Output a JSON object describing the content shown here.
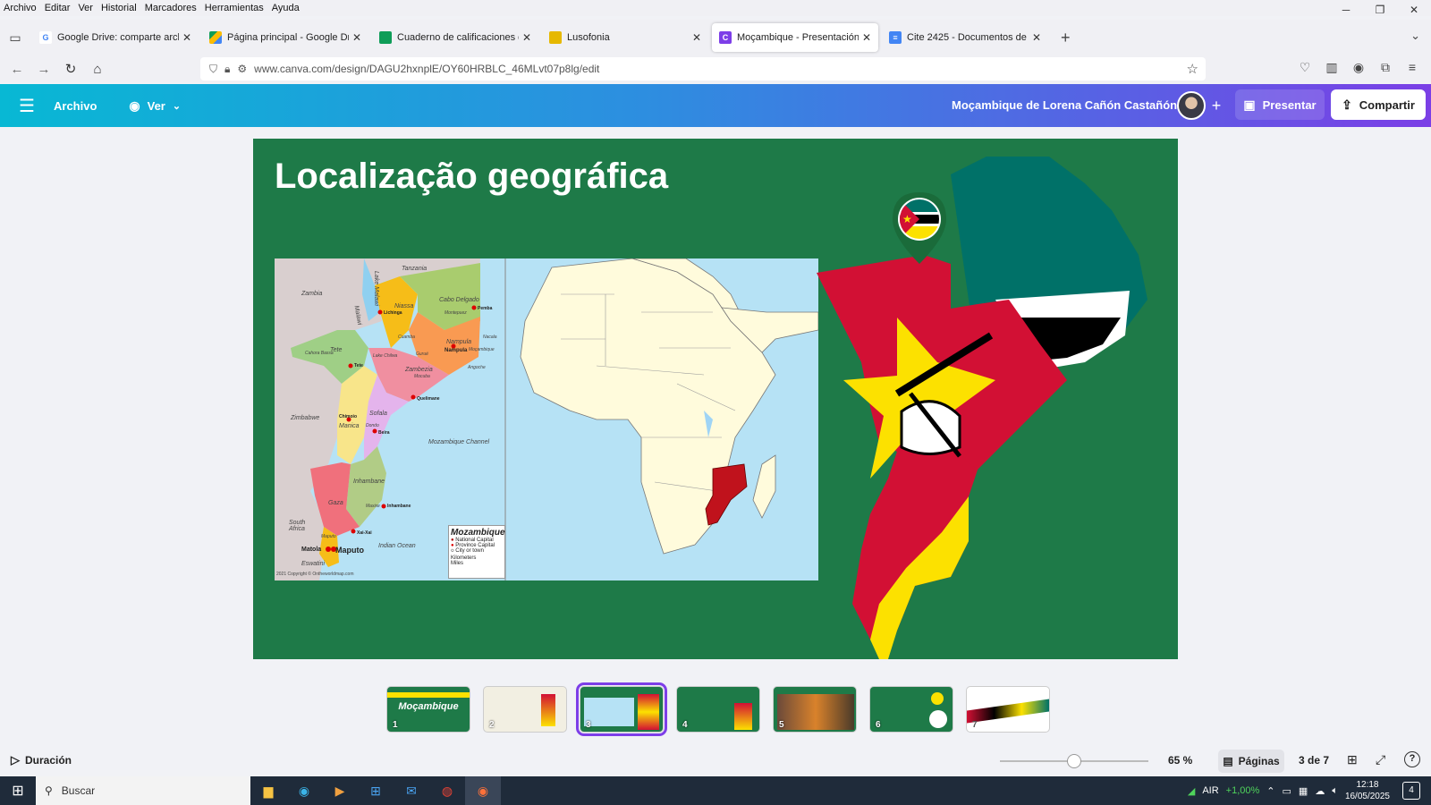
{
  "menubar": {
    "items": [
      "Archivo",
      "Editar",
      "Ver",
      "Historial",
      "Marcadores",
      "Herramientas",
      "Ayuda"
    ]
  },
  "tabs": [
    {
      "label": "Google Drive: comparte archivos",
      "favicon": "google-icon",
      "color": "#4285f4",
      "active": false
    },
    {
      "label": "Página principal - Google Drive",
      "favicon": "drive-icon",
      "color": "#0f9d58",
      "active": false
    },
    {
      "label": "Cuaderno de calificaciones de 2",
      "favicon": "classroom-icon",
      "color": "#0f9d58",
      "active": false
    },
    {
      "label": "Lusofonia",
      "favicon": "classroom-icon",
      "color": "#e6b800",
      "active": false
    },
    {
      "label": "Moçambique - Presentación",
      "favicon": "canva-icon",
      "color": "#7d3ee8",
      "active": true
    },
    {
      "label": "Cite 2425 - Documentos de Goo",
      "favicon": "docs-icon",
      "color": "#4285f4",
      "active": false
    }
  ],
  "url": "www.canva.com/design/DAGU2hxnplE/OY60HRBLC_46MLvt07p8lg/edit",
  "canva": {
    "archivo": "Archivo",
    "ver": "Ver",
    "doc_title": "Moçambique de Lorena Cañón Castañón",
    "present": "Presentar",
    "share": "Compartir"
  },
  "slide": {
    "title": "Localização geográfica",
    "map_labels": {
      "tanzania": "Tanzania",
      "zambia": "Zambia",
      "lake_malawi": "Lake Malawi",
      "malawi": "Malawi",
      "niassa": "Niassa",
      "cabo_delgado": "Cabo Delgado",
      "lichinga": "Lichinga",
      "pemba": "Pemba",
      "nampula_prov": "Nampula",
      "nampula_city": "Nampula",
      "nacala": "Nacala",
      "cuamba": "Cuamba",
      "gurue": "Gurué",
      "tete_prov": "Tete",
      "tete_city": "Tete",
      "cahora_bassa": "Cahora Bassa",
      "lake_chilwa": "Lake Chilwa",
      "zambezia": "Zambezia",
      "mocuba": "Mocuba",
      "quelimane": "Quelimane",
      "angoche": "Angoche",
      "mozambique_island": "Moçambique",
      "montepuez": "Montepuez",
      "zimbabwe": "Zimbabwe",
      "chimoio": "Chimoio",
      "manica": "Manica",
      "sofala": "Sofala",
      "dondo": "Dondo",
      "beira": "Beira",
      "mozambique_channel": "Mozambique Channel",
      "inhambane_prov": "Inhambane",
      "inhambane_city": "Inhambane",
      "maxixe": "Maxixe",
      "gaza": "Gaza",
      "xai_xai": "Xai-Xai",
      "south_africa": "South Africa",
      "maputo_prov": "Maputo",
      "matola": "Matola",
      "maputo_city": "Maputo",
      "indian_ocean": "Indian Ocean",
      "eswatini": "Eswatini",
      "copyright": "2021 Copyright © Ontheworldmap.com"
    },
    "legend": {
      "title": "Mozambique",
      "national_capital": "National Capital",
      "province_capital": "Province Capital",
      "city": "City or town",
      "km": "Kilometers",
      "miles": "Miles"
    }
  },
  "thumbnails": [
    {
      "num": "1",
      "text": "Moçambique",
      "bg": "#1e7a48"
    },
    {
      "num": "2",
      "text": "",
      "bg": "#f2efe2"
    },
    {
      "num": "3",
      "text": "",
      "bg": "#1e7a48"
    },
    {
      "num": "4",
      "text": "",
      "bg": "#1e7a48"
    },
    {
      "num": "5",
      "text": "",
      "bg": "#1e7a48"
    },
    {
      "num": "6",
      "text": "",
      "bg": "#1e7a48"
    },
    {
      "num": "7",
      "text": "",
      "bg": "#ffffff"
    }
  ],
  "bottombar": {
    "duration": "Duración",
    "zoom": "65 %",
    "zoom_fraction": 0.5,
    "pages": "Páginas",
    "page_count": "3 de 7"
  },
  "taskbar": {
    "search": "Buscar",
    "air": "AIR",
    "pct": "+1,00%",
    "time": "12:18",
    "date": "16/05/2025",
    "notif_count": "4"
  },
  "colors": {
    "slide_bg": "#1e7a48",
    "flag_red": "#d21034",
    "flag_yellow": "#fce100",
    "flag_green": "#007168",
    "accent": "#7d3ee8"
  }
}
